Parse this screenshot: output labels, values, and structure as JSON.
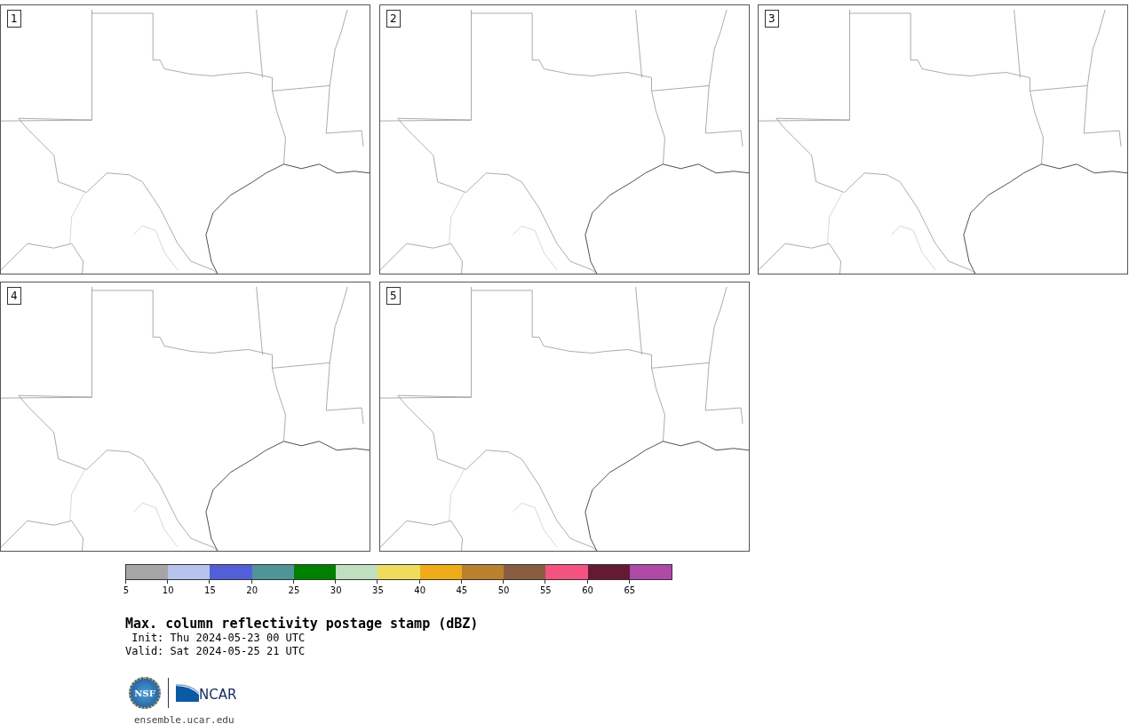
{
  "panels": [
    {
      "label": "1"
    },
    {
      "label": "2"
    },
    {
      "label": "3"
    },
    {
      "label": "4"
    },
    {
      "label": "5"
    }
  ],
  "colorbar": {
    "bins": [
      {
        "label": "5",
        "color": "#a5a5a5"
      },
      {
        "label": "10",
        "color": "#b7c3ec"
      },
      {
        "label": "15",
        "color": "#525fd8"
      },
      {
        "label": "20",
        "color": "#4f9499"
      },
      {
        "label": "25",
        "color": "#008000"
      },
      {
        "label": "30",
        "color": "#bfdfbf"
      },
      {
        "label": "35",
        "color": "#f0dc5c"
      },
      {
        "label": "40",
        "color": "#efac18"
      },
      {
        "label": "45",
        "color": "#b8812e"
      },
      {
        "label": "50",
        "color": "#895c3f"
      },
      {
        "label": "55",
        "color": "#f45280"
      },
      {
        "label": "60",
        "color": "#641934"
      },
      {
        "label": "65",
        "color": "#ae4aa5"
      }
    ]
  },
  "title": "Max. column reflectivity postage stamp (dBZ)",
  "init": " Init: Thu 2024-05-23 00 UTC",
  "valid": "Valid: Sat 2024-05-25 21 UTC",
  "logo": {
    "nsf": "NSF",
    "ncar": "NCAR"
  },
  "url": "ensemble.ucar.edu"
}
